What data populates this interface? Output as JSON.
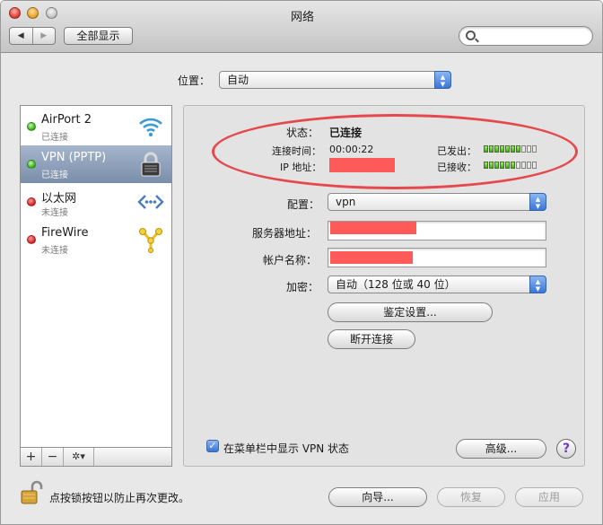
{
  "window": {
    "title": "网络"
  },
  "toolbar": {
    "back_glyph": "◀",
    "forward_glyph": "▶",
    "show_all_label": "全部显示",
    "search_value": ""
  },
  "location": {
    "label": "位置：",
    "value": "自动"
  },
  "services": [
    {
      "name": "AirPort 2",
      "status": "已连接",
      "dot": "green",
      "icon": "wifi-icon",
      "selected": false
    },
    {
      "name": "VPN (PPTP)",
      "status": "已连接",
      "dot": "green",
      "icon": "lock-icon",
      "selected": true
    },
    {
      "name": "以太网",
      "status": "未连接",
      "dot": "red",
      "icon": "ethernet-icon",
      "selected": false
    },
    {
      "name": "FireWire",
      "status": "未连接",
      "dot": "red",
      "icon": "firewire-icon",
      "selected": false
    }
  ],
  "sidebar_controls": {
    "add": "+",
    "remove": "−",
    "gear": "✲▾"
  },
  "vpn": {
    "status_label": "状态：",
    "status_value": "已连接",
    "connect_time_label": "连接时间：",
    "connect_time_value": "00:00:22",
    "ip_label": "IP 地址：",
    "sent_label": "已发出：",
    "received_label": "已接收：",
    "sent_level": 0.7,
    "received_level": 0.6,
    "config_label": "配置：",
    "config_value": "vpn",
    "server_label": "服务器地址：",
    "account_label": "帐户名称：",
    "encryption_label": "加密：",
    "encryption_value": "自动（128 位或 40 位）",
    "auth_button": "鉴定设置...",
    "disconnect_button": "断开连接",
    "show_in_menubar_label": "在菜单栏中显示 VPN 状态",
    "show_in_menubar_checked": true,
    "advanced_button": "高级...",
    "help_glyph": "?"
  },
  "footer": {
    "lock_text": "点按锁按钮以防止再次更改。",
    "assist_button": "向导...",
    "revert_button": "恢复",
    "apply_button": "应用"
  },
  "colors": {
    "annotation_circle": "#e5484d",
    "redaction": "#ff5a5a",
    "selection": "#8a9cb6"
  }
}
